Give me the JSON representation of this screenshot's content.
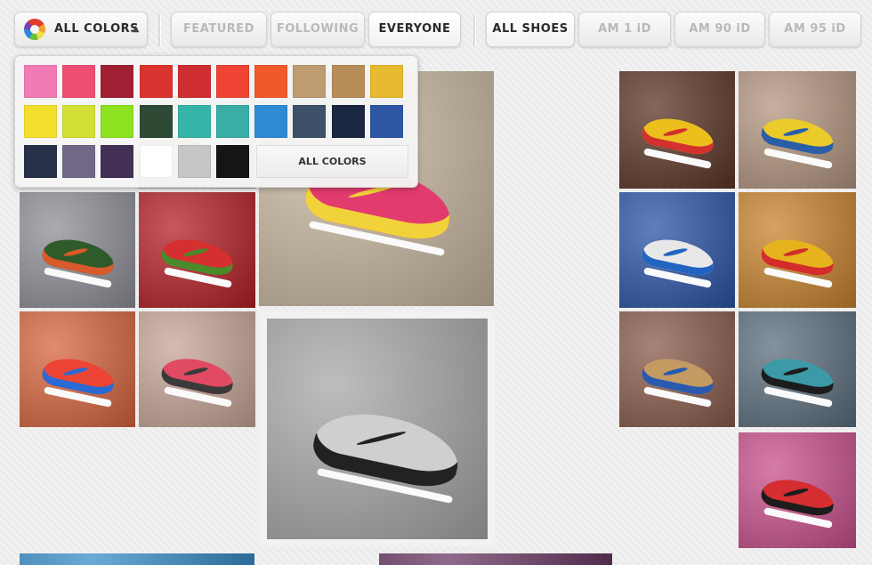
{
  "toolbar": {
    "colors_label": "ALL COLORS",
    "caret": "▲",
    "tabs": [
      {
        "label": "FEATURED",
        "active": false
      },
      {
        "label": "FOLLOWING",
        "active": false
      },
      {
        "label": "EVERYONE",
        "active": true
      }
    ],
    "filters": [
      {
        "label": "ALL SHOES",
        "active": true
      },
      {
        "label": "AM 1 iD",
        "active": false
      },
      {
        "label": "AM 90 iD",
        "active": false
      },
      {
        "label": "AM 95 iD",
        "active": false
      }
    ]
  },
  "color_panel": {
    "swatches_row1": [
      "#f27bb5",
      "#ef4e73",
      "#a11f33",
      "#d9322f",
      "#cf2d32",
      "#ef4433",
      "#f05a2b",
      "#bf9b70",
      "#b78d5a",
      "#e7bb2f"
    ],
    "swatches_row2": [
      "#f1df2c",
      "#d2df35",
      "#8de11f",
      "#2e4a34",
      "#35b5a7",
      "#38aea4",
      "#2f8ad2",
      "#3d5169",
      "#1b2740",
      "#2d56a5"
    ],
    "swatches_row3": [
      "#27324a",
      "#726886",
      "#433155",
      "#ffffff",
      "#c5c6c6",
      "#151515"
    ],
    "all_colors_label": "ALL COLORS"
  },
  "photos": [
    {
      "id": "nyc-sneaker-1",
      "bg": "#d9d0c6",
      "shoe": "#e8f1f9",
      "accent": "#f2c12e"
    },
    {
      "id": "pink-sneaker-cereal",
      "bg": "#c9b8a1",
      "shoe": "#e23b6e",
      "accent": "#f2d23a"
    },
    {
      "id": "green-sneaker-girl",
      "bg": "#8e8e96",
      "shoe": "#2f5a2a",
      "accent": "#d95a2a"
    },
    {
      "id": "red-sneaker-cherries",
      "bg": "#b31e26",
      "shoe": "#d52f30",
      "accent": "#4a8a2a"
    },
    {
      "id": "sneaker-candy",
      "bg": "#d7643e",
      "shoe": "#ec4535",
      "accent": "#2a6ad4"
    },
    {
      "id": "pink-sneaker-bag",
      "bg": "#c7a597",
      "shoe": "#e04a63",
      "accent": "#3a3a3a"
    },
    {
      "id": "grey-sneaker-bw",
      "bg": "#a8a8a8",
      "shoe": "#cfcfcf",
      "accent": "#222222"
    },
    {
      "id": "yellow-sneaker-banana",
      "bg": "#5c3526",
      "shoe": "#ecbf1d",
      "accent": "#d2312d"
    },
    {
      "id": "yellow-sneaker-table",
      "bg": "#b3957e",
      "shoe": "#eacb2a",
      "accent": "#2a5ea9"
    },
    {
      "id": "blue-sneaker-sky",
      "bg": "#2a53a6",
      "shoe": "#e8e8e8",
      "accent": "#2264c2"
    },
    {
      "id": "orange-sneaker-wall",
      "bg": "#c9832c",
      "shoe": "#e6b31d",
      "accent": "#d32c2c"
    },
    {
      "id": "tan-sneaker-friends",
      "bg": "#8a5a4a",
      "shoe": "#c49a63",
      "accent": "#2a5ab0"
    },
    {
      "id": "teal-sneaker-street",
      "bg": "#5b6e7d",
      "shoe": "#3b9aa6",
      "accent": "#1c1c1c"
    },
    {
      "id": "red-sneaker-flower",
      "bg": "#c9508c",
      "shoe": "#d52d30",
      "accent": "#1c1c1c"
    },
    {
      "id": "blue-strip",
      "bg": "#3a8ecb",
      "shoe": "",
      "accent": ""
    },
    {
      "id": "dark-strip",
      "bg": "#6a3a64",
      "shoe": "",
      "accent": ""
    }
  ]
}
